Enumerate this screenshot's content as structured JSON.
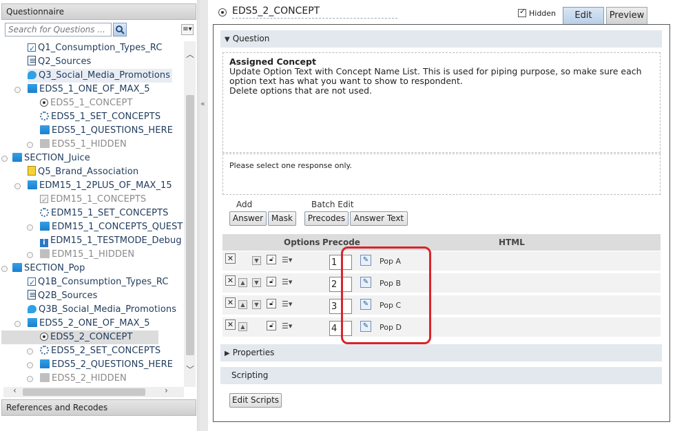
{
  "left_panel": {
    "header": "Questionnaire",
    "search_placeholder": "Search for Questions ...",
    "filter_icon": "≡▾",
    "tree": [
      {
        "label": "Q1_Consumption_Types_RC",
        "icon": "checkbox-icon"
      },
      {
        "label": "Q2_Sources",
        "icon": "grid-list-icon"
      },
      {
        "label": "Q3_Social_Media_Promotions",
        "icon": "bubble-icon"
      },
      {
        "label": "EDS5_1_ONE_OF_MAX_5",
        "icon": "folder-icon"
      },
      {
        "label": "EDS5_1_CONCEPT",
        "icon": "radio-icon"
      },
      {
        "label": "EDS5_1_SET_CONCEPTS",
        "icon": "gear-icon"
      },
      {
        "label": "EDS5_1_QUESTIONS_HERE",
        "icon": "folder-icon"
      },
      {
        "label": "EDS5_1_HIDDEN",
        "icon": "folder-icon"
      },
      {
        "label": "SECTION_Juice",
        "icon": "folder-icon"
      },
      {
        "label": "Q5_Brand_Association",
        "icon": "list-icon"
      },
      {
        "label": "EDM15_1_2PLUS_OF_MAX_15",
        "icon": "folder-icon"
      },
      {
        "label": "EDM15_1_CONCEPTS",
        "icon": "checkbox-icon"
      },
      {
        "label": "EDM15_1_SET_CONCEPTS",
        "icon": "gear-icon"
      },
      {
        "label": "EDM15_1_CONCEPTS_QUEST",
        "icon": "folder-icon"
      },
      {
        "label": "EDM15_1_TESTMODE_Debug",
        "icon": "info-icon"
      },
      {
        "label": "EDM15_1_HIDDEN",
        "icon": "folder-icon"
      },
      {
        "label": "SECTION_Pop",
        "icon": "folder-icon"
      },
      {
        "label": "Q1B_Consumption_Types_RC",
        "icon": "checkbox-icon"
      },
      {
        "label": "Q2B_Sources",
        "icon": "grid-list-icon"
      },
      {
        "label": "Q3B_Social_Media_Promotions",
        "icon": "bubble-icon"
      },
      {
        "label": "EDS5_2_ONE_OF_MAX_5",
        "icon": "folder-icon"
      },
      {
        "label": "EDS5_2_CONCEPT",
        "icon": "radio-icon"
      },
      {
        "label": "EDS5_2_SET_CONCEPTS",
        "icon": "gear-icon"
      },
      {
        "label": "EDS5_2_QUESTIONS_HERE",
        "icon": "folder-icon"
      },
      {
        "label": "EDS5_2_HIDDEN",
        "icon": "folder-icon"
      }
    ],
    "references": "References and Recodes"
  },
  "editor": {
    "question_name": "EDS5_2_CONCEPT",
    "hidden_label": "Hidden",
    "hidden_checked": true,
    "tabs": {
      "edit": "Edit",
      "preview": "Preview"
    },
    "section_question": "Question",
    "assigned_title": "Assigned Concept",
    "assigned_line1": "Update Option Text with Concept Name List. This is used for piping purpose, so make sure each",
    "assigned_line2": "option text has what you want to show to respondent.",
    "assigned_line3": "Delete options that are not used.",
    "instruction": "Please select one response only.",
    "add_label": "Add",
    "batch_label": "Batch Edit",
    "buttons": {
      "answer": "Answer",
      "mask": "Mask",
      "precodes": "Precodes",
      "answer_text": "Answer Text"
    },
    "grid_headers": {
      "options": "Options",
      "precode": "Precode",
      "html": "HTML"
    },
    "rows": [
      {
        "precode": "1",
        "html": "Pop A"
      },
      {
        "precode": "2",
        "html": "Pop B"
      },
      {
        "precode": "3",
        "html": "Pop C"
      },
      {
        "precode": "4",
        "html": "Pop D"
      }
    ],
    "section_properties": "Properties",
    "section_scripting": "Scripting",
    "edit_scripts": "Edit Scripts"
  },
  "colors": {
    "highlight": "#d8232a",
    "accent": "#1c7fcc"
  }
}
